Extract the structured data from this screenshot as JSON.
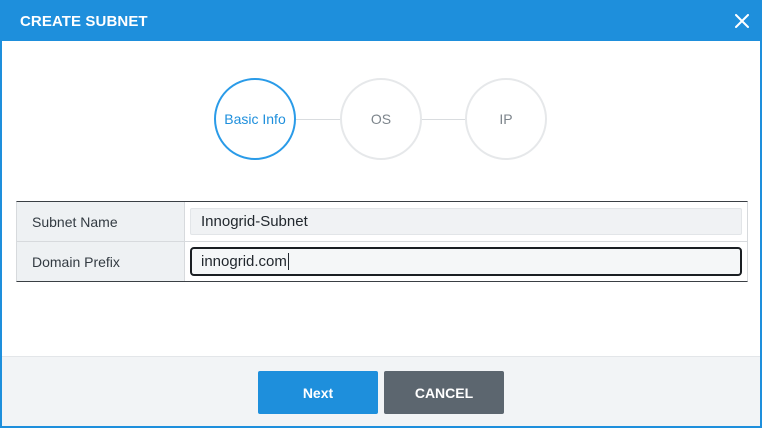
{
  "dialog": {
    "title": "CREATE SUBNET",
    "close_icon": "close-icon"
  },
  "steps": [
    {
      "label": "Basic Info",
      "state": "active"
    },
    {
      "label": "OS",
      "state": "inactive"
    },
    {
      "label": "IP",
      "state": "inactive"
    }
  ],
  "form": {
    "rows": [
      {
        "label": "Subnet Name",
        "value": "Innogrid-Subnet"
      },
      {
        "label": "Domain Prefix",
        "value": "innogrid.com"
      }
    ]
  },
  "footer": {
    "next_label": "Next",
    "cancel_label": "CANCEL"
  },
  "colors": {
    "primary": "#1e8fdc",
    "cancel": "#5c666f",
    "step_active": "#2a9be8",
    "step_inactive_border": "#e6e8ea"
  }
}
